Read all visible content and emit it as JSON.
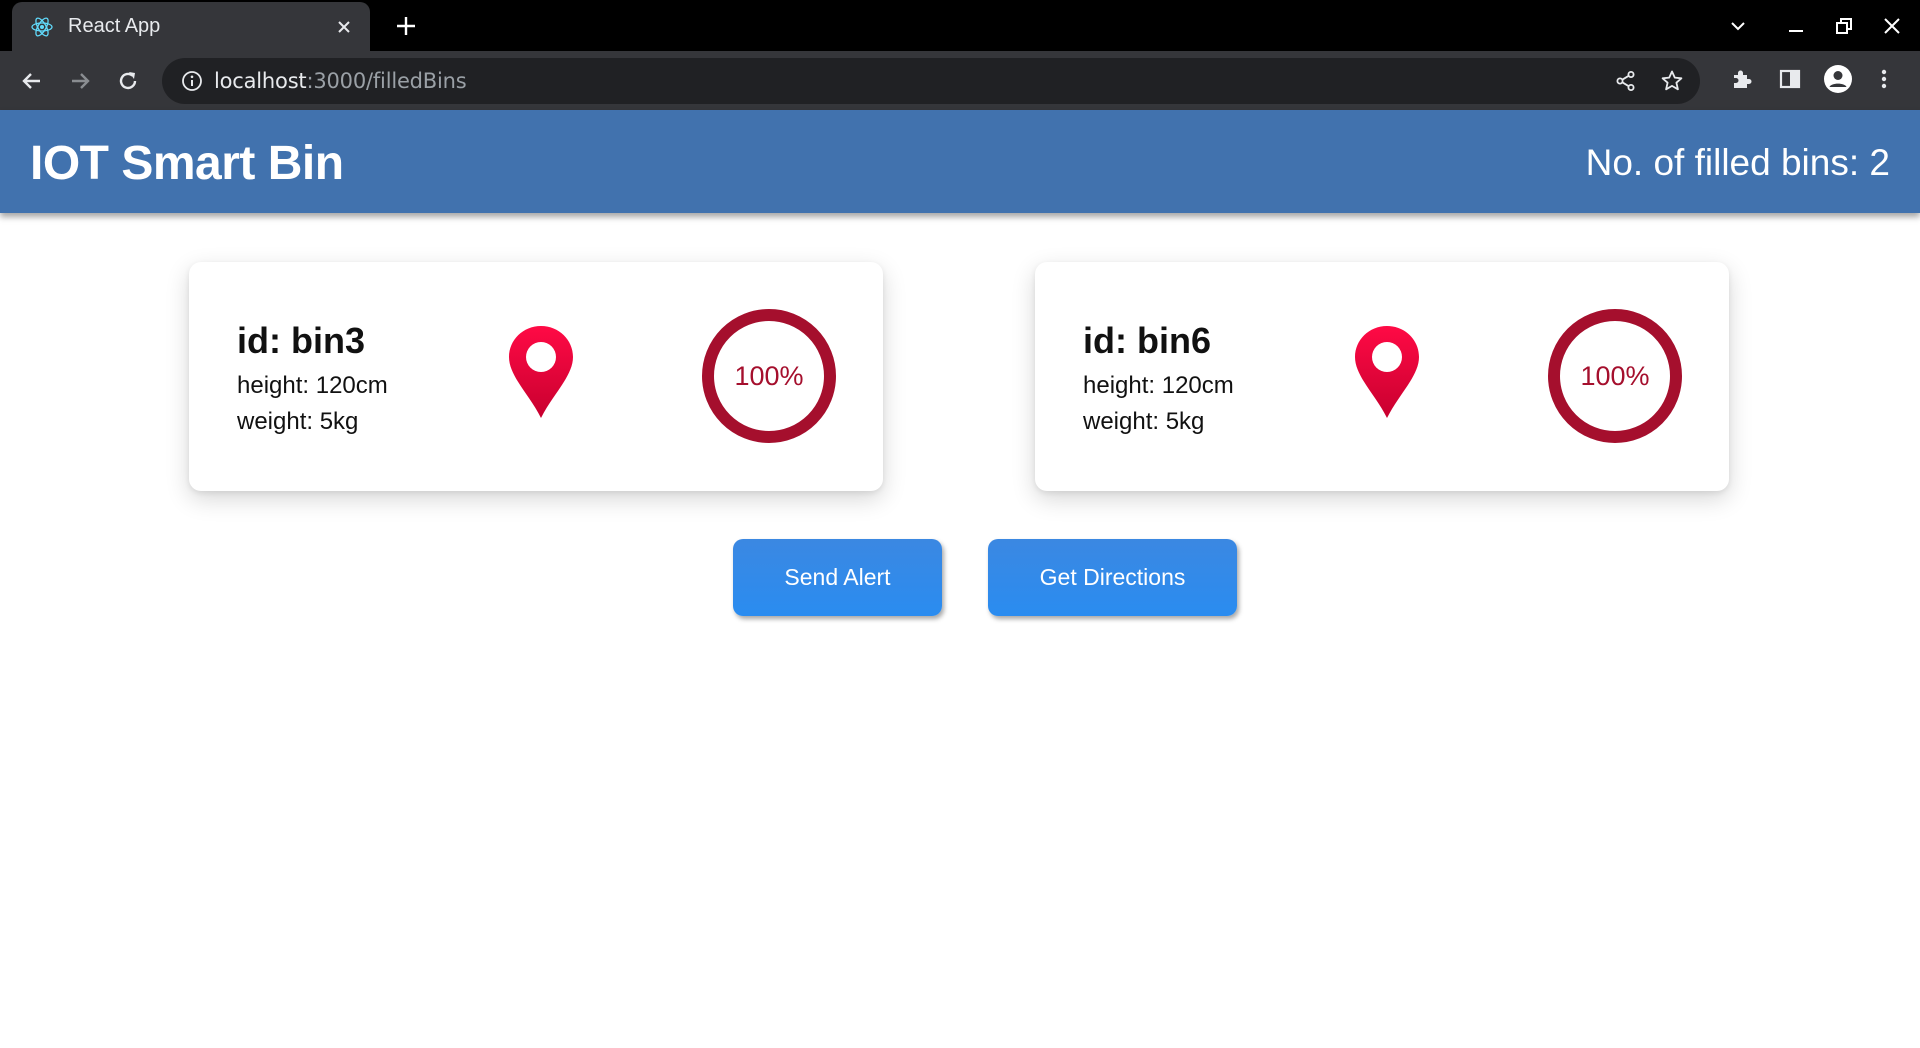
{
  "browser": {
    "tab_title": "React App",
    "url_host": "localhost",
    "url_path": ":3000/filledBins"
  },
  "app": {
    "title": "IOT Smart Bin",
    "filled_count_label": "No. of filled bins: 2"
  },
  "bins": [
    {
      "id": "id: bin3",
      "height": "height: 120cm",
      "weight": "weight: 5kg",
      "fill_label": "100%",
      "fill": 1.0
    },
    {
      "id": "id: bin6",
      "height": "height: 120cm",
      "weight": "weight: 5kg",
      "fill_label": "100%",
      "fill": 1.0
    }
  ],
  "actions": {
    "send_alert": "Send Alert",
    "get_directions": "Get Directions"
  },
  "colors": {
    "appbar": "#4172ae",
    "ring": "#a50f2d",
    "pin": "#e8003a",
    "button": "#2a8cf0"
  },
  "icons": {
    "favicon": "react-icon",
    "location": "map-pin-icon"
  }
}
